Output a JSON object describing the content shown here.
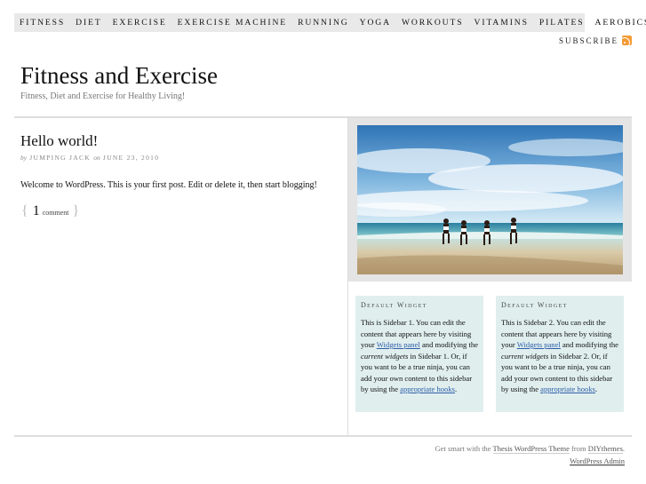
{
  "nav": {
    "items": [
      "FITNESS",
      "DIET",
      "EXERCISE",
      "EXERCISE MACHINE",
      "RUNNING",
      "YOGA",
      "WORKOUTS",
      "VITAMINS",
      "PILATES",
      "AEROBICS"
    ],
    "subscribe_label": "SUBSCRIBE",
    "subscribe_icon": "rss-icon"
  },
  "header": {
    "title": "Fitness and Exercise",
    "tagline": "Fitness, Diet and Exercise for Healthy Living!"
  },
  "post": {
    "title": "Hello world!",
    "by_prefix": "by",
    "author": "JUMPING JACK",
    "on_prefix": "on",
    "date": "JUNE 23, 2010",
    "body": "Welcome to WordPress. This is your first post. Edit or delete it, then start blogging!",
    "comment_count": "1",
    "comment_label": "comment",
    "brace_open": "{",
    "brace_close": "}"
  },
  "sidebar": {
    "image_alt": "beach-runners-image",
    "widgets": [
      {
        "title": "Default Widget",
        "t1": "This is Sidebar 1. You can edit the content that appears here by visiting your ",
        "link1": "Widgets panel",
        "t2": " and modifying the ",
        "em": "current widgets",
        "t3": " in Sidebar 1. Or, if you want to be a true ninja, you can add your own content to this sidebar by using the ",
        "link2": "appropriate hooks",
        "t4": "."
      },
      {
        "title": "Default Widget",
        "t1": "This is Sidebar 2. You can edit the content that appears here by visiting your ",
        "link1": "Widgets panel",
        "t2": " and modifying the ",
        "em": "current widgets",
        "t3": " in Sidebar 2. Or, if you want to be a true ninja, you can add your own content to this sidebar by using the ",
        "link2": "appropriate hooks",
        "t4": "."
      }
    ]
  },
  "footer": {
    "prefix": "Get smart with the ",
    "theme_link": "Thesis WordPress Theme",
    "middle": " from ",
    "diy_link": "DIYthemes",
    "suffix": ".",
    "admin_link": "WordPress Admin"
  },
  "colors": {
    "nav_bg": "#e9e9e9",
    "widget_bg": "#e0eeee",
    "link": "#2d5ea8",
    "rss": "#f59a35"
  }
}
